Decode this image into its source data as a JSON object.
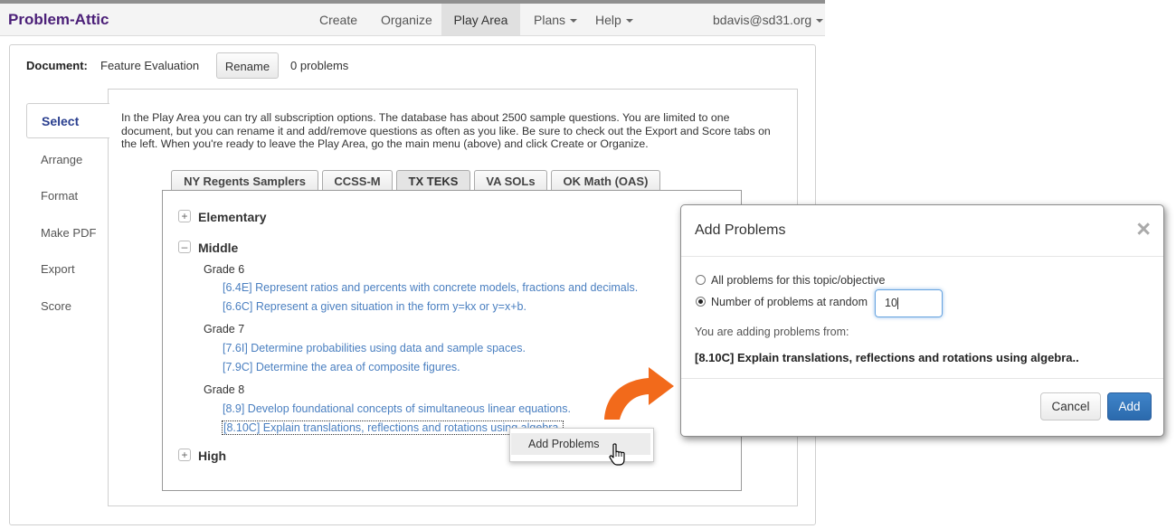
{
  "nav": {
    "brand": "Problem-Attic",
    "items": [
      {
        "label": "Create"
      },
      {
        "label": "Organize"
      },
      {
        "label": "Play Area"
      },
      {
        "label": "Plans"
      },
      {
        "label": "Help"
      }
    ],
    "user": "bdavis@sd31.org",
    "active_item": "Play Area"
  },
  "document": {
    "label": "Document:",
    "name": "Feature Evaluation",
    "rename_label": "Rename",
    "problem_count": "0 problems"
  },
  "side_tabs": [
    "Select",
    "Arrange",
    "Format",
    "Make PDF",
    "Export",
    "Score"
  ],
  "active_side_tab": "Select",
  "intro_text": "In the Play Area you can try all subscription options. The database has about 2500 sample questions. You are limited to one document, but you can rename it and add/remove questions as often as you like. Be sure to check out the Export and Score tabs on the left. When you're ready to leave the Play Area, go the main menu (above) and click Create or Organize.",
  "standards_tabs": [
    "NY Regents Samplers",
    "CCSS-M",
    "TX TEKS",
    "VA SOLs",
    "OK Math (OAS)"
  ],
  "active_standards_tab": "TX TEKS",
  "tree": {
    "levels": [
      {
        "toggle": "+",
        "label": "Elementary"
      },
      {
        "toggle": "–",
        "label": "Middle"
      },
      {
        "toggle": "+",
        "label": "High"
      }
    ],
    "grades": [
      {
        "label": "Grade 6",
        "topics": [
          "[6.4E] Represent ratios and percents with concrete models, fractions and decimals.",
          "[6.6C] Represent a given situation in the form y=kx or y=x+b."
        ]
      },
      {
        "label": "Grade 7",
        "topics": [
          "[7.6I] Determine probabilities using data and sample spaces.",
          "[7.9C] Determine the area of composite figures."
        ]
      },
      {
        "label": "Grade 8",
        "topics": [
          "[8.9] Develop foundational concepts of simultaneous linear equations.",
          "[8.10C] Explain translations, reflections and rotations using algebra."
        ]
      }
    ]
  },
  "context_menu": {
    "item": "Add Problems"
  },
  "modal": {
    "title": "Add Problems",
    "close_glyph": "×",
    "option_all": "All problems for this topic/objective",
    "option_random": "Number of problems at random",
    "random_count": "10",
    "adding_from_label": "You are adding problems from:",
    "target_topic": "[8.10C] Explain translations, reflections and rotations using algebra..",
    "cancel_label": "Cancel",
    "add_label": "Add"
  },
  "colors": {
    "brand": "#4b1f78",
    "link": "#4a7fc0",
    "primary_button": "#2b6aad",
    "arrow": "#f26a1b"
  }
}
